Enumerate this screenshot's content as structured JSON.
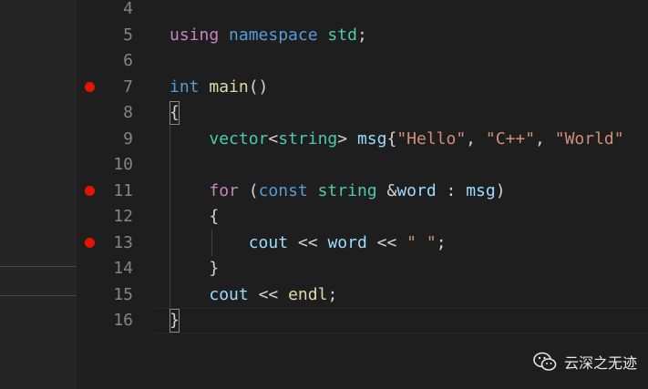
{
  "line_numbers": [
    "4",
    "5",
    "6",
    "7",
    "8",
    "9",
    "10",
    "11",
    "12",
    "13",
    "14",
    "15",
    "16"
  ],
  "breakpoints": [
    "7",
    "11",
    "13"
  ],
  "code": {
    "l5": [
      "using",
      "namespace",
      "std",
      ";"
    ],
    "l7": [
      "int",
      "main",
      "()"
    ],
    "l8": [
      "{"
    ],
    "l9": [
      "vector",
      "<",
      "string",
      ">",
      "msg",
      "{",
      "\"Hello\"",
      ", ",
      "\"C++\"",
      ", ",
      "\"World\""
    ],
    "l11": [
      "for",
      "(",
      "const",
      "string",
      "&",
      "word",
      " : ",
      "msg",
      ")"
    ],
    "l12": [
      "{"
    ],
    "l13": [
      "cout",
      "<<",
      "word",
      "<<",
      "\" \"",
      ";"
    ],
    "l14": [
      "}"
    ],
    "l15": [
      "cout",
      "<<",
      "endl",
      ";"
    ],
    "l16": [
      "}"
    ]
  },
  "watermark": {
    "text": "云深之无迹",
    "icon": "wechat-icon"
  },
  "colors": {
    "background": "#1e1e1e",
    "breakpoint": "#e51400",
    "keyword": "#c586c0",
    "type": "#4ec9b0",
    "function": "#dcdcaa",
    "variable": "#9cdcfe",
    "string": "#ce9178"
  }
}
